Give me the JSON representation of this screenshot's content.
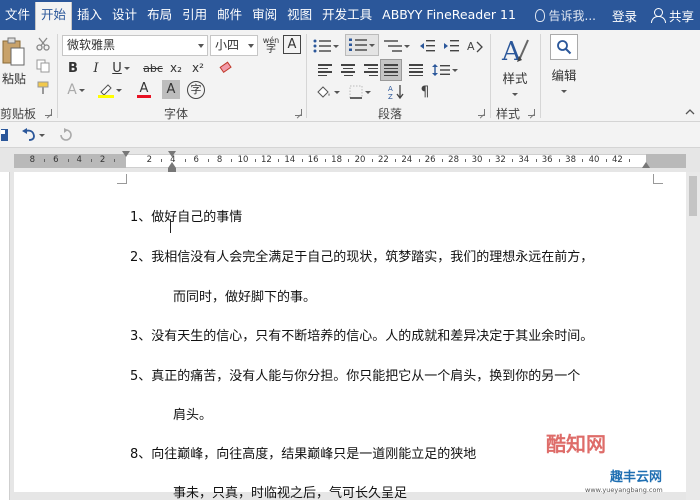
{
  "tabs": [
    "文件",
    "开始",
    "插入",
    "设计",
    "布局",
    "引用",
    "邮件",
    "审阅",
    "视图",
    "开发工具",
    "ABBYY FineReader 11"
  ],
  "tell_me": "告诉我...",
  "login": "登录",
  "share": "共享",
  "ribbon": {
    "paste_label": "粘贴",
    "clipboard_group": "剪贴板",
    "font_name": "微软雅黑",
    "font_size": "小四",
    "font_group": "字体",
    "paragraph_group": "段落",
    "styles_label": "样式",
    "styles_group": "样式",
    "edit_label": "编辑",
    "phonetic": "wén",
    "char_border": "A",
    "bold": "B",
    "italic": "I",
    "underline": "U",
    "strike": "abc",
    "subscript": "x₂",
    "superscript": "x²",
    "font_color": "A",
    "char_shading": "A",
    "enclose": "字",
    "grow": "A",
    "aa": "Aa",
    "effects": "A"
  },
  "ruler_numbers": [
    "8",
    "6",
    "4",
    "2",
    "2",
    "4",
    "6",
    "8",
    "10",
    "12",
    "14",
    "16",
    "18",
    "20",
    "22",
    "24",
    "26",
    "28",
    "30",
    "32",
    "34",
    "36",
    "38",
    "40",
    "42"
  ],
  "document_lines": [
    "1、做好自己的事情",
    "2、我相信没有人会完全满足于自己的现状，筑梦踏实，我们的理想永远在前方，",
    "而同时，做好脚下的事。",
    "3、没有天生的信心，只有不断培养的信心。人的成就和差异决定于其业余时间。",
    "5、真正的痛苦，没有人能与你分担。你只能把它从一个肩头，换到你的另一个",
    "肩头。",
    "8、向往巅峰，向往高度，结果巅峰只是一道刚能立足的狭地",
    "事未，只真，时临视之后，气可长久呈足"
  ],
  "watermark": {
    "brand": "酷知网",
    "site": "趣丰云网",
    "url": "www.yueyangbang.com"
  },
  "colors": {
    "accent": "#2b579a",
    "highlight": "#ffff00",
    "font_color": "#e81123"
  }
}
